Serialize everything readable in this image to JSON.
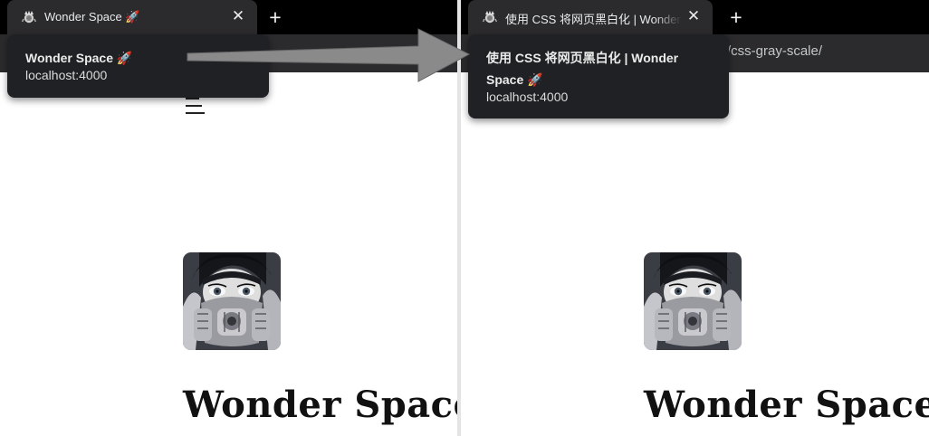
{
  "left_window": {
    "tab": {
      "title": "Wonder Space 🚀",
      "close_glyph": "✕",
      "favicon": "site-favicon-icon"
    },
    "new_tab_glyph": "+",
    "tooltip": {
      "title": "Wonder Space 🚀",
      "url": "localhost:4000"
    },
    "page": {
      "site_title": "Wonder Space",
      "menu_icon": "hamburger-menu-icon"
    }
  },
  "right_window": {
    "tab": {
      "title": "使用 CSS 将网页黑白化 | Wonder Space 🚀",
      "close_glyph": "✕",
      "favicon": "site-favicon-icon"
    },
    "new_tab_glyph": "+",
    "address_bar": {
      "visible_url_part": "/css-gray-scale/"
    },
    "tooltip": {
      "title": "使用 CSS 将网页黑白化 | Wonder Space 🚀",
      "url": "localhost:4000"
    },
    "page": {
      "site_title": "Wonder Space"
    }
  },
  "annotation": {
    "arrow_color": "#8a8a8a",
    "arrow_icon": "right-arrow-icon"
  },
  "colors": {
    "tab_strip": "#000000",
    "active_tab": "#2b2b2e",
    "tooltip_bg": "#202124",
    "page_bg": "#ffffff",
    "title_text": "#111111"
  }
}
